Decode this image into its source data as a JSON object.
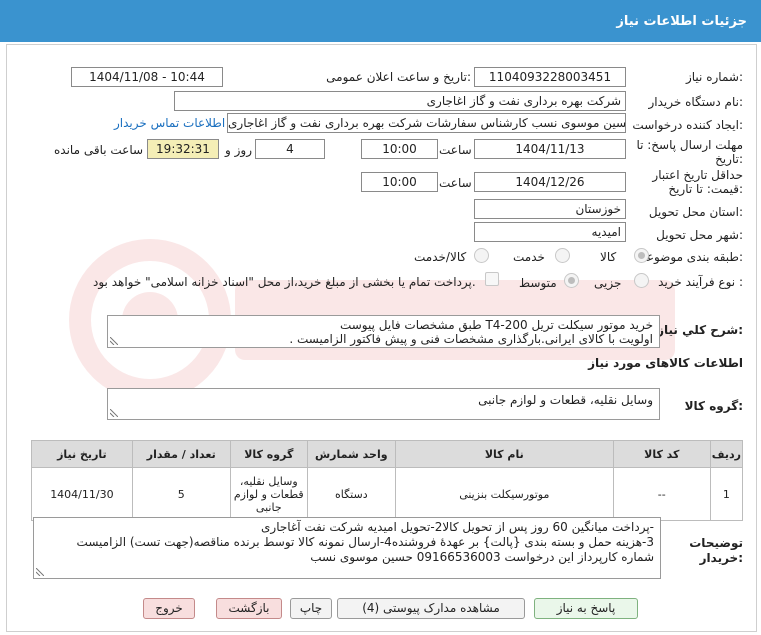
{
  "header": {
    "title": "جزئیات اطلاعات نیاز"
  },
  "form": {
    "need_number_label": "شماره نیاز:",
    "need_number": "1104093228003451",
    "announce_label": "تاریخ و ساعت اعلان عمومی:",
    "announce_value": "1404/11/08 - 10:44",
    "buyer_org_label": "نام دستگاه خریدار:",
    "buyer_org": "شرکت بهره برداری نفت و گاز اغاجاری",
    "requester_label": "ایجاد کننده درخواست:",
    "requester": "حسین موسوی نسب کارشناس سفارشات شرکت بهره برداری نفت و گاز اغاجاری",
    "contact_link": "اطلاعات تماس خریدار",
    "deadline_label_1": "مهلت ارسال پاسخ: تا",
    "deadline_label_2": "تاریخ:",
    "deadline_date": "1404/11/13",
    "time_label": "ساعت",
    "deadline_time": "10:00",
    "days_value": "4",
    "days_label": "روز و",
    "remaining_time": "19:32:31",
    "remaining_label": "ساعت باقی مانده",
    "validity_label_1": "حداقل تاریخ اعتبار",
    "validity_label_2": "قیمت: تا تاریخ:",
    "validity_date": "1404/12/26",
    "validity_time_label": "ساعت",
    "validity_time": "10:00",
    "province_label": "استان محل تحویل:",
    "province": "خوزستان",
    "city_label": "شهر محل تحویل:",
    "city": "امیدیه",
    "category_label": "طبقه بندی موضوعی:",
    "category_options": [
      "کالا",
      "خدمت",
      "کالا/خدمت"
    ],
    "category_selected": "کالا",
    "process_label": "نوع فرآیند خرید :",
    "process_options": [
      "جزیی",
      "متوسط"
    ],
    "process_selected": "متوسط",
    "payment_note": "پرداخت تمام یا بخشی از مبلغ خرید،از محل \"اسناد خزانه اسلامی\" خواهد بود."
  },
  "description": {
    "label": "شرح کلي نياز:",
    "line1": "خرید  موتور سیکلت تریل T4-200  طبق مشخصات فایل پیوست",
    "line2": "اولویت با کالای ایرانی.بارگذاری مشخصات فنی و پیش فاکتور الزامیست ."
  },
  "goods_info_title": "اطلاعات کالاهای مورد نیاز",
  "goods_group": {
    "label": "گروه کالا:",
    "value": "وسایل نقلیه، قطعات و لوازم جانبی"
  },
  "table": {
    "headers": [
      "ردیف",
      "کد کالا",
      "نام کالا",
      "واحد شمارش",
      "گروه کالا",
      "تعداد / مقدار",
      "تاریخ نیاز"
    ],
    "rows": [
      {
        "row": "1",
        "code": "--",
        "name": "موتورسیکلت بنزینی",
        "unit": "دستگاه",
        "group": "وسایل نقلیه، قطعات و لوازم جانبی",
        "qty": "5",
        "date": "1404/11/30"
      }
    ]
  },
  "notes": {
    "label_1": "توضیحات",
    "label_2": "خریدار:",
    "line1": "-پرداخت میانگین 60 روز پس از تحویل کالا2-تحویل امیدیه شرکت نفت آغاجاری",
    "line2": "3-هزینه حمل  و بسته بندی {پالت} بر عهدهٔ فروشنده4-ارسال نمونه کالا توسط برنده مناقصه(جهت تست) الزامیست",
    "line3": "شماره کارپرداز این درخواست 09166536003 حسین موسوی نسب"
  },
  "buttons": {
    "reply": "پاسخ به نیاز",
    "docs": "مشاهده مدارک پیوستی (4)",
    "print": "چاپ",
    "back": "بازگشت",
    "exit": "خروج"
  }
}
